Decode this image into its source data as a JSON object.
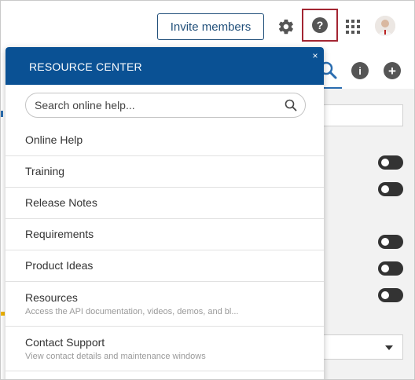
{
  "topbar": {
    "invite_label": "Invite members",
    "icons": [
      "gear-icon",
      "help-icon",
      "apps-grid-icon",
      "avatar"
    ],
    "help_highlight_color": "#a32532"
  },
  "background": {
    "toolbar_icons": [
      "search-icon",
      "info-icon",
      "add-icon"
    ],
    "toggle_count": 5,
    "accent_color": "#2a6db0"
  },
  "resource_center": {
    "title": "RESOURCE CENTER",
    "close_symbol": "×",
    "header_color": "#0a5194",
    "search_placeholder": "Search online help...",
    "items": [
      {
        "label": "Online Help"
      },
      {
        "label": "Training"
      },
      {
        "label": "Release Notes"
      },
      {
        "label": "Requirements"
      },
      {
        "label": "Product Ideas"
      },
      {
        "label": "Resources",
        "description": "Access the API documentation, videos, demos, and bl..."
      },
      {
        "label": "Contact Support",
        "description": "View contact details and maintenance windows"
      }
    ]
  }
}
